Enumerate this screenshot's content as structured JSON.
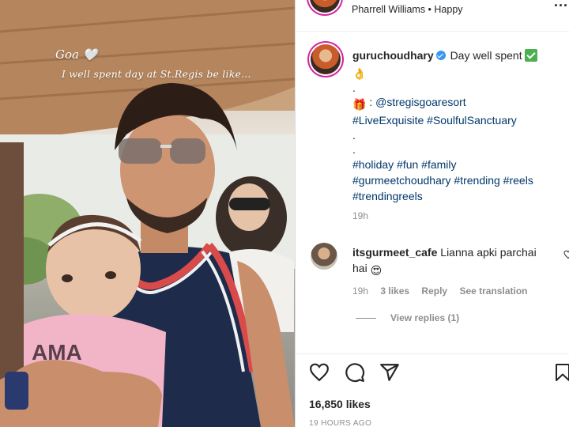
{
  "media": {
    "caption_line1": "Goa 🤍",
    "caption_line2": "I well spent day at St.Regis be like..."
  },
  "post": {
    "audio_text": "Pharrell Williams • Happy",
    "more_label": "...",
    "author": "guruchoudhary",
    "caption_line1": "Day well spent",
    "caption_dot1": ".",
    "mention": "@stregisgoaresort",
    "hashtags_line1": "#LiveExquisite #SoulfulSanctuary",
    "caption_dot2": ".",
    "caption_dot3": ".",
    "hashtags_line2": "#holiday #fun #family",
    "hashtags_line3": "#gurmeetchoudhary #trending #reels",
    "hashtags_line4": "#trendingreels",
    "time": "19h",
    "likes": "16,850 likes",
    "time_ago": "19 HOURS AGO"
  },
  "comment": {
    "author": "itsgurmeet_cafe",
    "text_line1": "Lianna apki parchai",
    "text_line2": "hai",
    "time": "19h",
    "likes": "3 likes",
    "reply_label": "Reply",
    "translation_label": "See translation",
    "view_replies": "View replies (1)"
  },
  "colors": {
    "link": "#00376b",
    "muted": "#8e8e8e",
    "verified": "#3897f0",
    "story_ring": "#d6249f"
  },
  "icons": [
    "heart-icon",
    "comment-icon",
    "share-icon",
    "bookmark-icon",
    "verified-icon",
    "check-emoji",
    "ok-hand-emoji",
    "gift-emoji",
    "heart-eyes-emoji",
    "white-heart-emoji"
  ]
}
